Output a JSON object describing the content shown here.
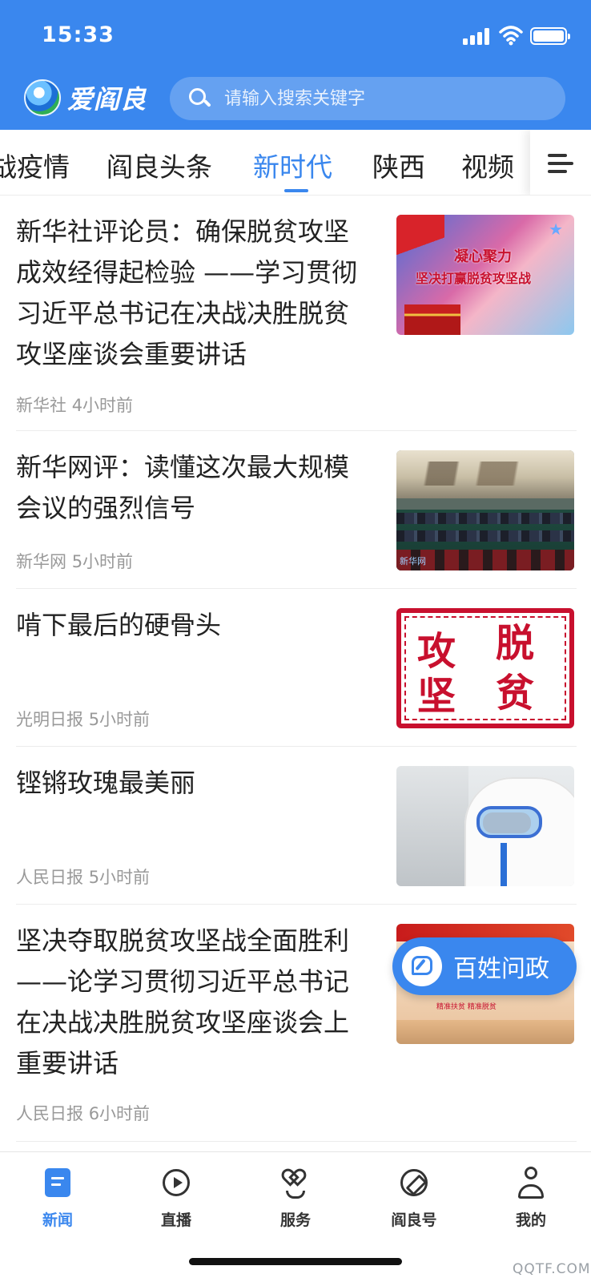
{
  "status_bar": {
    "time": "15:33"
  },
  "header": {
    "app_name": "爱阎良",
    "search_placeholder": "请输入搜索关键字"
  },
  "tabs": [
    {
      "label": "战疫情",
      "active": false
    },
    {
      "label": "阎良头条",
      "active": false
    },
    {
      "label": "新时代",
      "active": true
    },
    {
      "label": "陕西",
      "active": false
    },
    {
      "label": "视频",
      "active": false
    }
  ],
  "news": [
    {
      "title": "新华社评论员：确保脱贫攻坚成效经得起检验 ——学习贯彻习近平总书记在决战决胜脱贫攻坚座谈会重要讲话",
      "source": "新华社",
      "time": "4小时前",
      "thumb_text": [
        "凝心聚力",
        "坚决打赢脱贫攻坚战"
      ]
    },
    {
      "title": "新华网评：读懂这次最大规模会议的强烈信号",
      "source": "新华网",
      "time": "5小时前",
      "thumb_text": [
        "新华网"
      ]
    },
    {
      "title": "啃下最后的硬骨头",
      "source": "光明日报",
      "time": "5小时前",
      "thumb_text": [
        "脱",
        "攻",
        "贫",
        "坚"
      ]
    },
    {
      "title": "铿锵玫瑰最美丽",
      "source": "人民日报",
      "time": "5小时前",
      "thumb_text": []
    },
    {
      "title": "坚决夺取脱贫攻坚战全面胜利——论学习贯彻习近平总书记在决战决胜脱贫攻坚座谈会上重要讲话",
      "source": "人民日报",
      "time": "6小时前",
      "thumb_text": [
        "精准扶贫  精准脱贫"
      ]
    }
  ],
  "floating_button": {
    "label": "百姓问政",
    "icon": "chat-edit-icon"
  },
  "bottom_nav": [
    {
      "label": "新闻",
      "icon": "news-icon",
      "active": true
    },
    {
      "label": "直播",
      "icon": "play-icon",
      "active": false
    },
    {
      "label": "服务",
      "icon": "heart-hands-icon",
      "active": false
    },
    {
      "label": "阎良号",
      "icon": "compass-icon",
      "active": false
    },
    {
      "label": "我的",
      "icon": "user-icon",
      "active": false
    }
  ],
  "watermark": "QQTF.COM",
  "colors": {
    "primary": "#3a87ee",
    "text": "#222222",
    "meta": "#999999",
    "accent_red": "#c8102e"
  }
}
